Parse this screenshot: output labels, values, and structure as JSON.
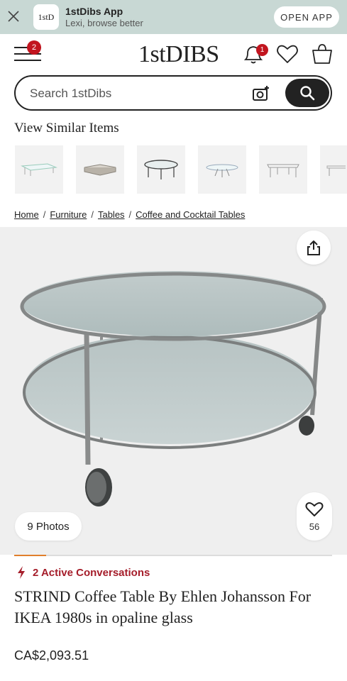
{
  "app_banner": {
    "title": "1stDibs App",
    "subtitle": "Lexi, browse better",
    "open_label": "OPEN APP",
    "logo_text": "1stD"
  },
  "header": {
    "logo": "1stDIBS",
    "menu_badge": "2",
    "notifications_badge": "1"
  },
  "search": {
    "placeholder": "Search 1stDibs"
  },
  "similar": {
    "heading": "View Similar Items"
  },
  "breadcrumb": [
    "Home",
    "Furniture",
    "Tables",
    "Coffee and Cocktail Tables"
  ],
  "gallery": {
    "photos_label": "9 Photos",
    "favorites_count": "56",
    "progress": 0.1
  },
  "product": {
    "conversations": "2 Active Conversations",
    "title": "STRIND Coffee Table By Ehlen Johansson For IKEA 1980s in opaline glass",
    "price": "CA$2,093.51"
  },
  "colors": {
    "banner_bg": "#c8d8d4",
    "badge_red": "#c2151f",
    "conversation_red": "#a51d2a",
    "progress_orange": "#e07f2c",
    "hero_bg": "#efefef"
  },
  "icons": [
    "close-icon",
    "app-logo-icon",
    "menu-icon",
    "bell-icon",
    "heart-icon",
    "shopping-bag-icon",
    "camera-search-icon",
    "search-icon",
    "share-icon",
    "lightning-icon"
  ]
}
